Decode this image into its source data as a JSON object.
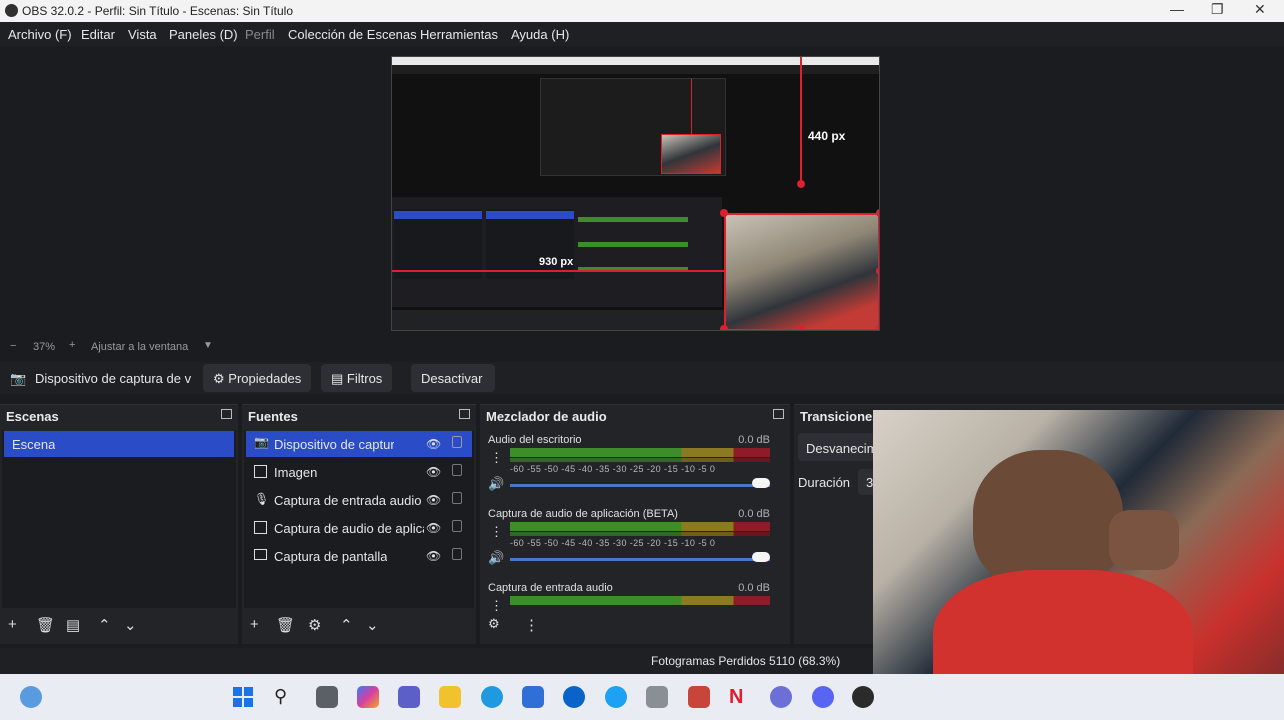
{
  "window": {
    "title": "OBS 32.0.2 - Perfil: Sin Título - Escenas: Sin Título"
  },
  "menu": {
    "items": [
      "Archivo (F)",
      "Editar",
      "Vista",
      "Paneles (D)",
      "Perfil",
      "Colección de Escenas",
      "Herramientas",
      "Ayuda (H)"
    ]
  },
  "preview": {
    "label_440": "440 px",
    "label_930": "930 px"
  },
  "zoom": {
    "minus": "−",
    "value": "37%",
    "plus": "+",
    "fit_label": "Ajustar a la ventana"
  },
  "context": {
    "source_name": "Dispositivo de captura de v",
    "properties_label": "Propiedades",
    "filters_label": "Filtros",
    "deactivate_label": "Desactivar"
  },
  "scenes": {
    "title": "Escenas",
    "items": [
      "Escena"
    ]
  },
  "sources": {
    "title": "Fuentes",
    "items": [
      "Dispositivo de captura de v",
      "Imagen",
      "Captura de entrada audio",
      "Captura de audio de aplica",
      "Captura de pantalla"
    ]
  },
  "mixer": {
    "title": "Mezclador de audio",
    "ticks": "-60 -55 -50 -45 -40 -35 -30 -25 -20 -15 -10 -5 0",
    "channels": [
      {
        "name": "Audio del escritorio",
        "db": "0.0 dB"
      },
      {
        "name": "Captura de audio de aplicación (BETA)",
        "db": "0.0 dB"
      },
      {
        "name": "Captura de entrada audio",
        "db": "0.0 dB"
      }
    ]
  },
  "transitions": {
    "title": "Transiciones",
    "selected": "Desvanecim",
    "duration_label": "Duración",
    "duration_value": "3"
  },
  "status": {
    "dropped": "Fotogramas Perdidos 5110 (68.3%)"
  },
  "icons": {
    "camera": "camera-icon",
    "gear": "gear-icon",
    "filter": "filter-icon",
    "eye": "eye-icon",
    "lock": "lock-icon",
    "add": "plus-icon",
    "remove": "trash-icon"
  },
  "colors": {
    "accent": "#2a4cc7",
    "record_red": "#e01e2e"
  }
}
